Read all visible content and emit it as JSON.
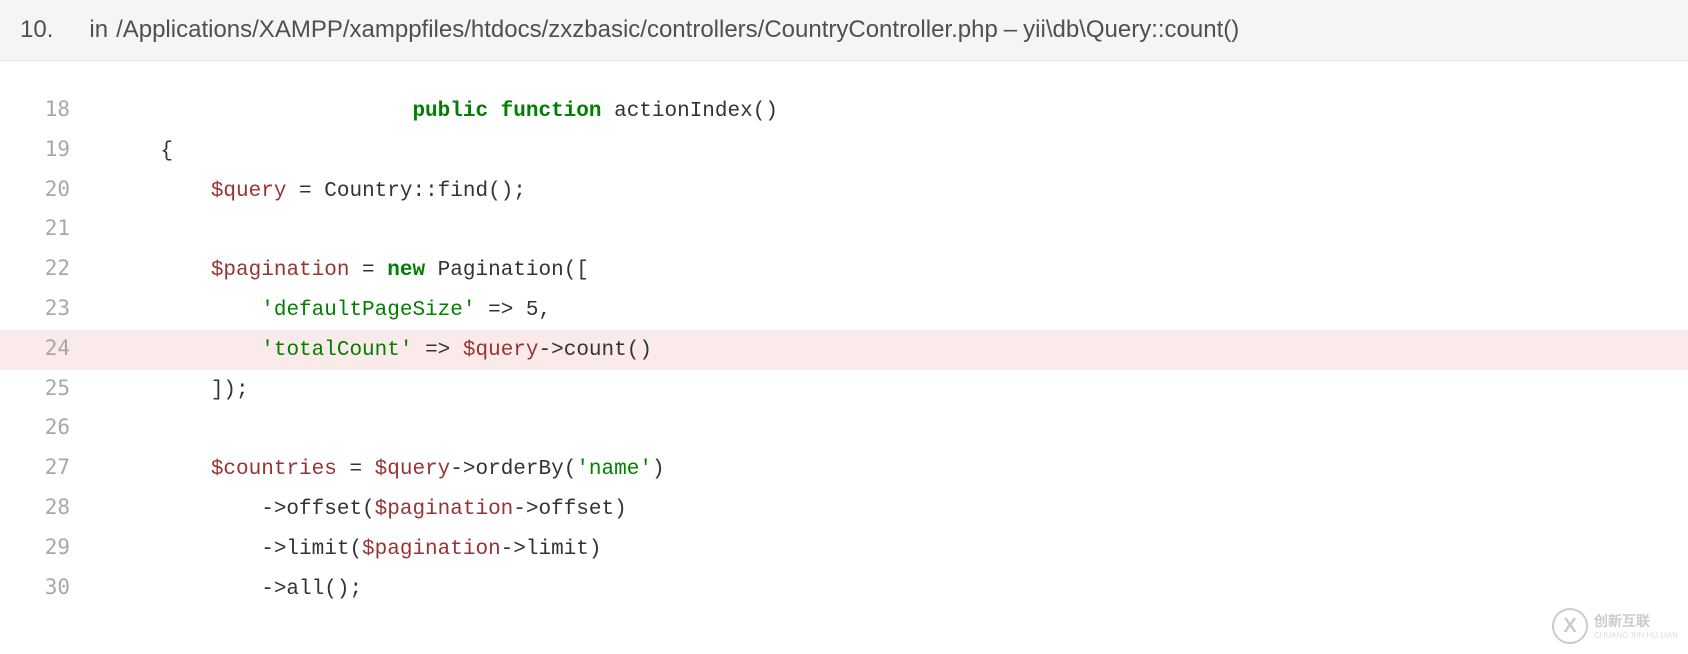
{
  "trace": {
    "number": "10.",
    "prefix": "in",
    "path": "/Applications/XAMPP/xamppfiles/htdocs/zxzbasic/controllers/CountryController.php",
    "separator": "–",
    "method": "yii\\db\\Query::count()"
  },
  "code": {
    "lines": [
      {
        "num": "18",
        "hl": false,
        "tokens": [
          {
            "cls": "pln",
            "t": "                        "
          },
          {
            "cls": "kw",
            "t": "public function"
          },
          {
            "cls": "pln",
            "t": " "
          },
          {
            "cls": "fn-name",
            "t": "actionIndex"
          },
          {
            "cls": "pln",
            "t": "()"
          }
        ]
      },
      {
        "num": "19",
        "hl": false,
        "tokens": [
          {
            "cls": "pln",
            "t": "    {"
          }
        ]
      },
      {
        "num": "20",
        "hl": false,
        "tokens": [
          {
            "cls": "pln",
            "t": "        "
          },
          {
            "cls": "var",
            "t": "$query"
          },
          {
            "cls": "pln",
            "t": " = Country::find();"
          }
        ]
      },
      {
        "num": "21",
        "hl": false,
        "tokens": [
          {
            "cls": "pln",
            "t": " "
          }
        ]
      },
      {
        "num": "22",
        "hl": false,
        "tokens": [
          {
            "cls": "pln",
            "t": "        "
          },
          {
            "cls": "var",
            "t": "$pagination"
          },
          {
            "cls": "pln",
            "t": " = "
          },
          {
            "cls": "kw",
            "t": "new"
          },
          {
            "cls": "pln",
            "t": " Pagination(["
          }
        ]
      },
      {
        "num": "23",
        "hl": false,
        "tokens": [
          {
            "cls": "pln",
            "t": "            "
          },
          {
            "cls": "str",
            "t": "'defaultPageSize'"
          },
          {
            "cls": "pln",
            "t": " => "
          },
          {
            "cls": "num",
            "t": "5"
          },
          {
            "cls": "pln",
            "t": ","
          }
        ]
      },
      {
        "num": "24",
        "hl": true,
        "tokens": [
          {
            "cls": "pln",
            "t": "            "
          },
          {
            "cls": "str",
            "t": "'totalCount'"
          },
          {
            "cls": "pln",
            "t": " => "
          },
          {
            "cls": "var",
            "t": "$query"
          },
          {
            "cls": "pln",
            "t": "->count()"
          }
        ]
      },
      {
        "num": "25",
        "hl": false,
        "tokens": [
          {
            "cls": "pln",
            "t": "        ]);"
          }
        ]
      },
      {
        "num": "26",
        "hl": false,
        "tokens": [
          {
            "cls": "pln",
            "t": " "
          }
        ]
      },
      {
        "num": "27",
        "hl": false,
        "tokens": [
          {
            "cls": "pln",
            "t": "        "
          },
          {
            "cls": "var",
            "t": "$countries"
          },
          {
            "cls": "pln",
            "t": " = "
          },
          {
            "cls": "var",
            "t": "$query"
          },
          {
            "cls": "pln",
            "t": "->orderBy("
          },
          {
            "cls": "str",
            "t": "'name'"
          },
          {
            "cls": "pln",
            "t": ")"
          }
        ]
      },
      {
        "num": "28",
        "hl": false,
        "tokens": [
          {
            "cls": "pln",
            "t": "            ->offset("
          },
          {
            "cls": "var",
            "t": "$pagination"
          },
          {
            "cls": "pln",
            "t": "->offset)"
          }
        ]
      },
      {
        "num": "29",
        "hl": false,
        "tokens": [
          {
            "cls": "pln",
            "t": "            ->limit("
          },
          {
            "cls": "var",
            "t": "$pagination"
          },
          {
            "cls": "pln",
            "t": "->limit)"
          }
        ]
      },
      {
        "num": "30",
        "hl": false,
        "tokens": [
          {
            "cls": "pln",
            "t": "            ->all();"
          }
        ]
      }
    ]
  },
  "watermark": {
    "glyph": "X",
    "text": "创新互联",
    "sub": "CHUANG XIN HU LIAN"
  }
}
